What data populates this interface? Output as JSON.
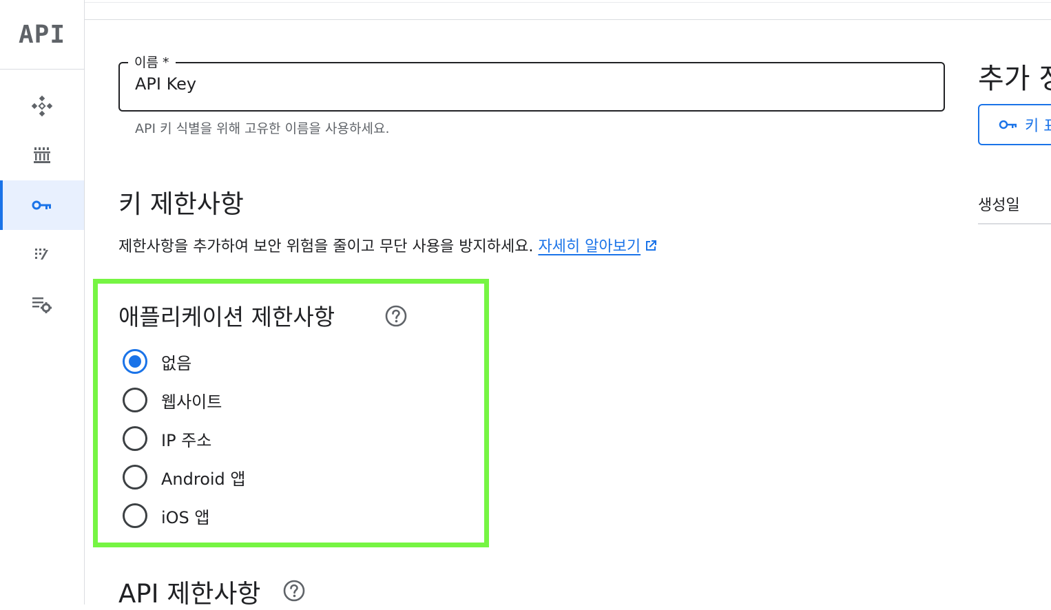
{
  "rail": {
    "logo": "API",
    "items": [
      {
        "icon": "overview-icon"
      },
      {
        "icon": "library-icon"
      },
      {
        "icon": "key-icon",
        "active": true
      },
      {
        "icon": "consent-icon"
      },
      {
        "icon": "settings-list-icon"
      }
    ]
  },
  "name_field": {
    "label": "이름 *",
    "value": "API Key",
    "hint": "API 키 식별을 위해 고유한 이름을 사용하세요."
  },
  "key_restrictions": {
    "title": "키 제한사항",
    "description": "제한사항을 추가하여 보안 위험을 줄이고 무단 사용을 방지하세요.",
    "learn_more": "자세히 알아보기"
  },
  "app_restrictions": {
    "title": "애플리케이션 제한사항",
    "options": [
      {
        "label": "없음",
        "selected": true
      },
      {
        "label": "웹사이트",
        "selected": false
      },
      {
        "label": "IP 주소",
        "selected": false
      },
      {
        "label": "Android 앱",
        "selected": false
      },
      {
        "label": "iOS 앱",
        "selected": false
      }
    ]
  },
  "api_restrictions": {
    "title": "API 제한사항"
  },
  "right_panel": {
    "title": "추가 정",
    "button_label": "키 표",
    "created_label": "생성일"
  },
  "colors": {
    "accent": "#1a73e8",
    "highlight": "#76f543"
  }
}
